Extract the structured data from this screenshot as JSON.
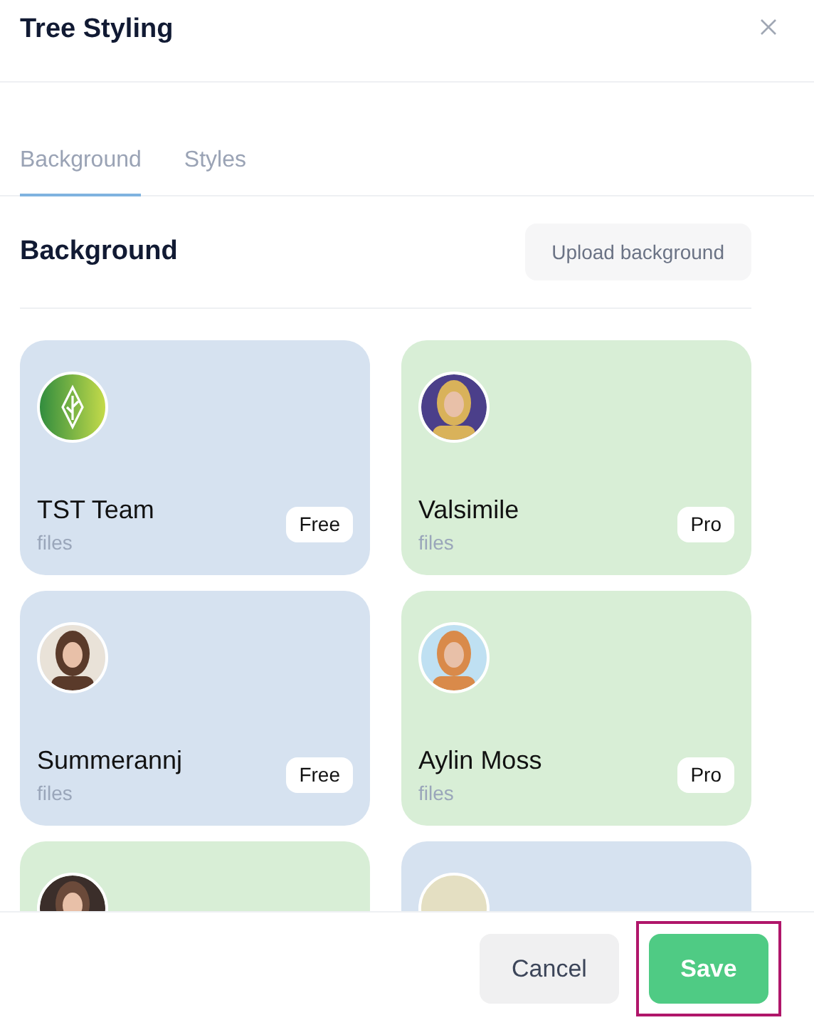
{
  "dialog": {
    "title": "Tree Styling"
  },
  "tabs": [
    {
      "label": "Background",
      "selected": true
    },
    {
      "label": "Styles",
      "selected": false
    }
  ],
  "section": {
    "title": "Background",
    "upload_button": "Upload background"
  },
  "cards": [
    {
      "avatar": {
        "kind": "logo"
      },
      "name": "TST Team",
      "subtitle": "files",
      "badge": "Free",
      "color": "#d6e2f0"
    },
    {
      "name": "Valsimile",
      "subtitle": "files",
      "badge": "Pro",
      "color": "#d8eed6"
    },
    {
      "name": "Summerannj",
      "subtitle": "files",
      "badge": "Free",
      "color": "#d6e2f0"
    },
    {
      "name": "Aylin Moss",
      "subtitle": "files",
      "badge": "Pro",
      "color": "#d8eed6"
    },
    {
      "color": "#d8eed6"
    },
    {
      "avatar": {
        "kind": "plain"
      },
      "color": "#d6e2f0"
    }
  ],
  "buttons": [
    {
      "label": "Cancel",
      "kind": "secondary",
      "highlighted": false
    },
    {
      "label": "Save",
      "kind": "primary",
      "highlighted": true
    }
  ]
}
